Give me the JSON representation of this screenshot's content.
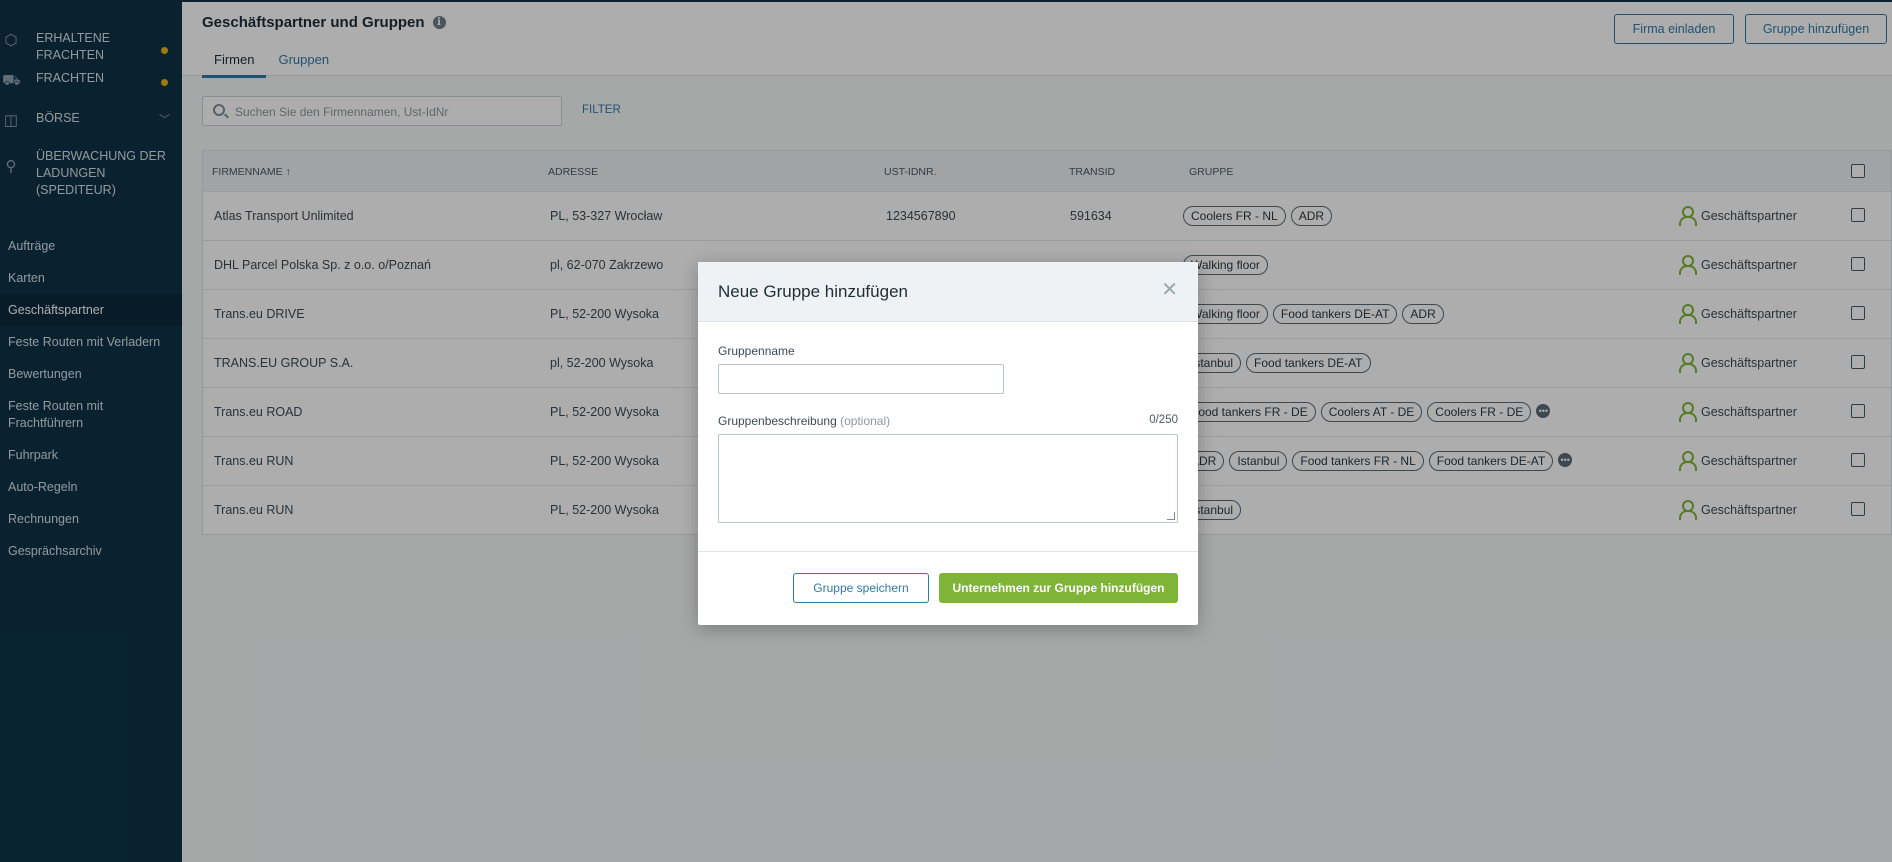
{
  "sidebar": {
    "main_items": [
      {
        "label": "ERHALTENE FRACHTEN",
        "icon": "box-icon",
        "dot": true
      },
      {
        "label": "FRACHTEN",
        "icon": "truck-icon",
        "dot": true
      },
      {
        "label": "BÖRSE",
        "icon": "cube-icon",
        "chevron": true
      },
      {
        "label": "ÜBERWACHUNG DER LADUNGEN (SPEDITEUR)",
        "icon": "satellite-icon"
      }
    ],
    "links": [
      "Aufträge",
      "Karten",
      "Geschäftspartner",
      "Feste Routen mit Verladern",
      "Bewertungen",
      "Feste Routen mit Frachtführern",
      "Fuhrpark",
      "Auto-Regeln",
      "Rechnungen",
      "Gesprächsarchiv"
    ],
    "active_link": "Geschäftspartner"
  },
  "header": {
    "title": "Geschäftspartner und Gruppen",
    "tabs": [
      "Firmen",
      "Gruppen"
    ],
    "invite_button": "Firma einladen",
    "add_group_button": "Gruppe hinzufügen"
  },
  "search": {
    "placeholder": "Suchen Sie den Firmennamen, Ust-IdNr",
    "filter_label": "FILTER"
  },
  "table": {
    "columns": [
      "FIRMENNAME ↑",
      "ADRESSE",
      "UST-IDNR.",
      "TRANSID",
      "GRUPPE"
    ],
    "rows": [
      {
        "name": "Atlas Transport Unlimited",
        "address": "PL, 53-327 Wrocław",
        "vat": "1234567890",
        "transid": "591634",
        "groups": [
          "Coolers FR - NL",
          "ADR"
        ],
        "more": false,
        "partner": "Geschäftspartner"
      },
      {
        "name": "DHL Parcel Polska Sp. z o.o. o/Poznań",
        "address": "pl, 62-070 Zakrzewo",
        "vat": "",
        "transid": "",
        "groups": [
          "Walking floor"
        ],
        "more": false,
        "partner": "Geschäftspartner"
      },
      {
        "name": "Trans.eu DRIVE",
        "address": "PL, 52-200 Wysoka",
        "vat": "",
        "transid": "",
        "groups": [
          "Walking floor",
          "Food tankers DE-AT",
          "ADR"
        ],
        "more": false,
        "partner": "Geschäftspartner"
      },
      {
        "name": "TRANS.EU GROUP S.A.",
        "address": "pl, 52-200 Wysoka",
        "vat": "",
        "transid": "",
        "groups": [
          "Istanbul",
          "Food tankers DE-AT"
        ],
        "more": false,
        "partner": "Geschäftspartner"
      },
      {
        "name": "Trans.eu ROAD",
        "address": "PL, 52-200 Wysoka",
        "vat": "",
        "transid": "",
        "groups": [
          "Food tankers FR - DE",
          "Coolers AT - DE",
          "Coolers FR - DE"
        ],
        "more": true,
        "partner": "Geschäftspartner"
      },
      {
        "name": "Trans.eu RUN",
        "address": "PL, 52-200 Wysoka",
        "vat": "",
        "transid": "",
        "groups": [
          "ADR",
          "Istanbul",
          "Food tankers FR - NL",
          "Food tankers DE-AT"
        ],
        "more": true,
        "partner": "Geschäftspartner"
      },
      {
        "name": "Trans.eu RUN",
        "address": "PL, 52-200 Wysoka",
        "vat": "",
        "transid": "",
        "groups": [
          "Istanbul"
        ],
        "more": false,
        "partner": "Geschäftspartner"
      }
    ]
  },
  "modal": {
    "title": "Neue Gruppe hinzufügen",
    "name_label": "Gruppenname",
    "name_value": "",
    "desc_label": "Gruppenbeschreibung",
    "desc_optional": "(optional)",
    "desc_counter": "0/250",
    "desc_value": "",
    "save_button": "Gruppe speichern",
    "add_companies_button": "Unternehmen zur Gruppe hinzufügen"
  },
  "colors": {
    "sidebar_bg": "#0f3347",
    "accent": "#2f7aa8",
    "primary_green": "#7fb536",
    "dot_yellow": "#e8b511"
  }
}
